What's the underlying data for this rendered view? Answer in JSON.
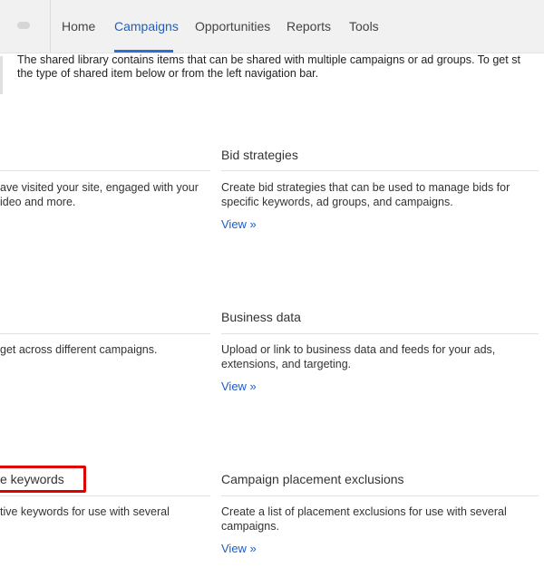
{
  "nav": {
    "tabs": [
      {
        "label": "Home"
      },
      {
        "label": "Campaigns",
        "active": true
      },
      {
        "label": "Opportunities"
      },
      {
        "label": "Reports"
      },
      {
        "label": "Tools"
      }
    ]
  },
  "intro": {
    "line1": "The shared library contains items that can be shared with multiple campaigns or ad groups. To get st",
    "line2": "the type of shared item below or from the left navigation bar."
  },
  "cards": {
    "audiences": {
      "desc_line1": "ave visited your site, engaged with your",
      "desc_line2": "ideo and more."
    },
    "bid_strategies": {
      "title": "Bid strategies",
      "desc_line1": "Create bid strategies that can be used to manage bids for",
      "desc_line2": "specific keywords, ad groups, and campaigns.",
      "link": "View »"
    },
    "budgets": {
      "desc_line1": "get across different campaigns."
    },
    "business_data": {
      "title": "Business data",
      "desc_line1": "Upload or link to business data and feeds for your ads,",
      "desc_line2": "extensions, and targeting.",
      "link": "View »"
    },
    "negative_keywords": {
      "title": "e keywords",
      "desc_line1": "tive keywords for use with several"
    },
    "placement_exclusions": {
      "title": "Campaign placement exclusions",
      "desc_line1": "Create a list of placement exclusions for use with several",
      "desc_line2": "campaigns.",
      "link": "View »"
    }
  },
  "colors": {
    "accent": "#1a5ec9",
    "highlight": "#e00000"
  }
}
